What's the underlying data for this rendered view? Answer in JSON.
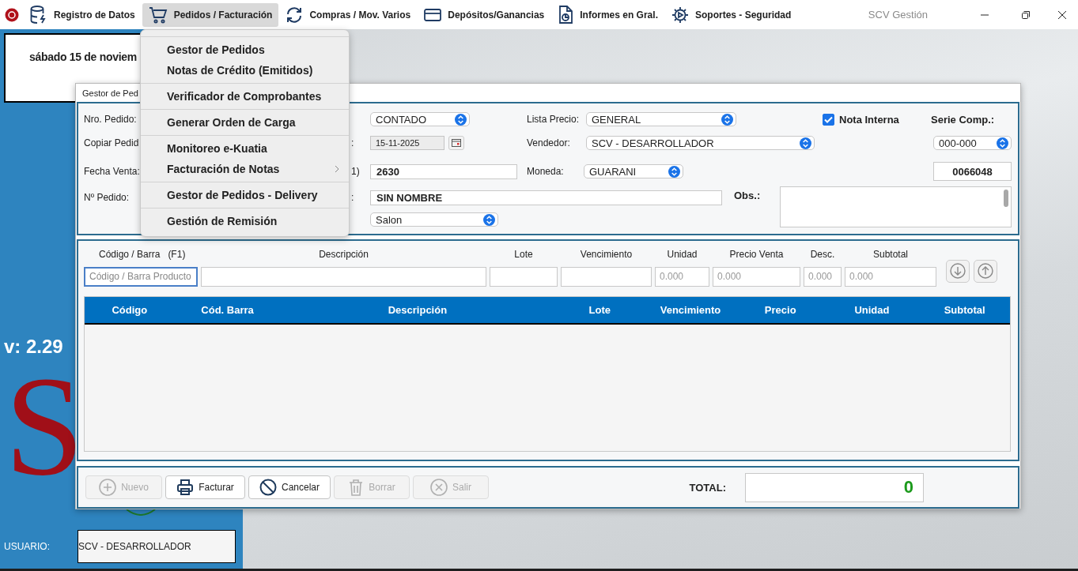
{
  "topbar": {
    "items": [
      {
        "label": "Registro de Datos",
        "selected": false
      },
      {
        "label": "Pedidos / Facturación",
        "selected": true
      },
      {
        "label": "Compras / Mov. Varios",
        "selected": false
      },
      {
        "label": "Depósitos/Ganancias",
        "selected": false
      },
      {
        "label": "Informes en Gral.",
        "selected": false
      },
      {
        "label": "Soportes - Seguridad",
        "selected": false
      }
    ],
    "title": "SCV Gestión"
  },
  "side_panel": {
    "date": "sábado 15 de noviem",
    "version": "v: 2.29",
    "logo": "S",
    "user_label": "USUARIO:",
    "user": "SCV - DESARROLLADOR"
  },
  "dialog": {
    "title": "Gestor de Ped",
    "header": {
      "labels": [
        "Nro. Pedido:",
        "Copiar Pedid",
        "Fecha Venta:",
        "Nº Pedido:"
      ],
      "label_fragments": [
        ":",
        "1)",
        ":"
      ],
      "condition": {
        "value": "CONTADO"
      },
      "date": {
        "value": "15-11-2025"
      },
      "field_row_3": {
        "value": "2630"
      },
      "field_row_4": {
        "value": "SIN NOMBRE"
      },
      "select_row_5": {
        "value": "Salon"
      },
      "price_list": {
        "label": "Lista Precio:",
        "value": "GENERAL"
      },
      "seller": {
        "label": "Vendedor:",
        "value": "SCV - DESARROLLADOR"
      },
      "currency": {
        "label": "Moneda:",
        "value": "GUARANI"
      },
      "internal_note": {
        "label": "Nota Interna",
        "checked": true
      },
      "series": {
        "label": "Serie Comp.:",
        "value": "000-000",
        "number": "0066048"
      },
      "obs": {
        "label": "Obs.:"
      }
    },
    "entry": {
      "columns": [
        {
          "label": "Código / Barra",
          "hint": "(F1)",
          "placeholder": "Código / Barra Producto"
        },
        {
          "label": "Descripción"
        },
        {
          "label": "Lote"
        },
        {
          "label": "Vencimiento"
        },
        {
          "label": "Unidad",
          "placeholder": "0.000"
        },
        {
          "label": "Precio Venta",
          "placeholder": "0.000"
        },
        {
          "label": "Desc.",
          "placeholder": "0.000"
        },
        {
          "label": "Subtotal",
          "placeholder": "0.000"
        }
      ]
    },
    "table": {
      "columns": [
        "Código",
        "Cód. Barra",
        "Descripción",
        "Lote",
        "Vencimiento",
        "Precio",
        "Unidad",
        "Subtotal"
      ]
    },
    "buttons": [
      {
        "label": "Nuevo",
        "disabled": true
      },
      {
        "label": "Facturar",
        "disabled": false
      },
      {
        "label": "Cancelar",
        "disabled": false
      },
      {
        "label": "Borrar",
        "disabled": true
      },
      {
        "label": "Salir",
        "disabled": true
      }
    ],
    "total": {
      "label": "TOTAL:",
      "value": "0"
    }
  },
  "menu": {
    "groups": [
      {
        "items": [
          {
            "label": "Gestor de Pedidos",
            "submenu": false
          },
          {
            "label": "Notas de Crédito (Emitidos)",
            "submenu": false
          }
        ]
      },
      {
        "items": [
          {
            "label": "Verificador de Comprobantes",
            "submenu": false
          }
        ]
      },
      {
        "items": [
          {
            "label": "Generar Orden de Carga",
            "submenu": false
          }
        ]
      },
      {
        "items": [
          {
            "label": "Monitoreo e-Kuatia",
            "submenu": false
          },
          {
            "label": "Facturación de Notas",
            "submenu": true
          }
        ]
      },
      {
        "items": [
          {
            "label": "Gestor de Pedidos - Delivery",
            "submenu": false
          }
        ]
      },
      {
        "items": [
          {
            "label": "Gestión de Remisión",
            "submenu": false
          }
        ]
      }
    ]
  }
}
